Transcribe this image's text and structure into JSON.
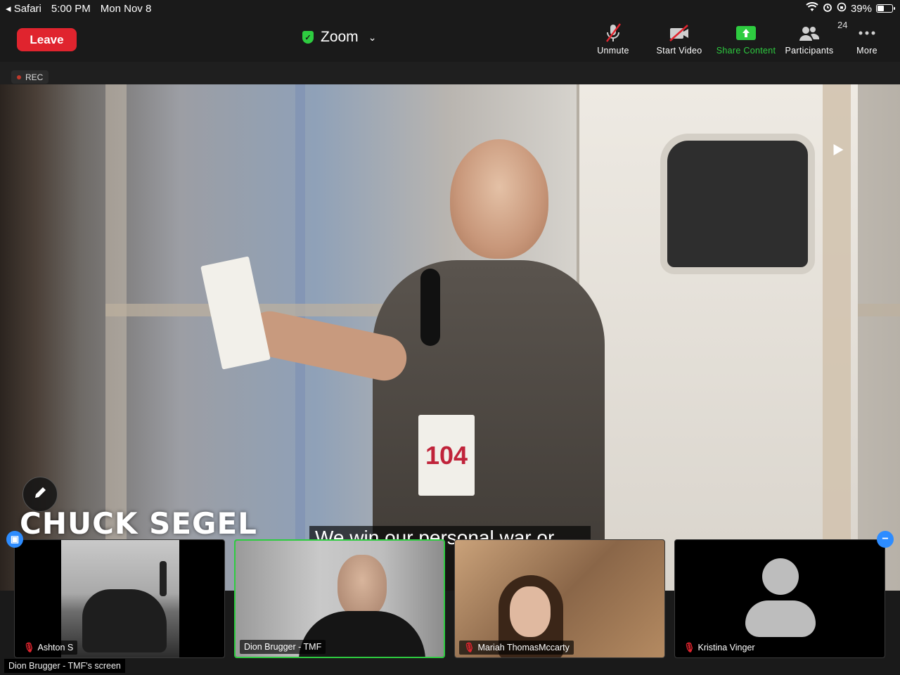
{
  "status_bar": {
    "back_app": "Safari",
    "time": "5:00 PM",
    "date": "Mon Nov 8",
    "battery": "39%",
    "battery_level": 0.39
  },
  "toolbar": {
    "leave_label": "Leave",
    "meeting_title": "Zoom",
    "buttons": {
      "unmute": "Unmute",
      "start_video": "Start Video",
      "share_content": "Share Content",
      "participants": "Participants",
      "participants_count": "24",
      "more": "More"
    }
  },
  "recording": {
    "label": "REC"
  },
  "shared_screen": {
    "name_overlay": "CHUCK SEGEL",
    "caption": "We win our personal war or",
    "bib_number": "104",
    "owner_label": "Dion Brugger - TMF's screen"
  },
  "participants": [
    {
      "name": "Ashton S",
      "muted": true
    },
    {
      "name": "Dion Brugger - TMF",
      "muted": false,
      "active_speaker": true
    },
    {
      "name": "Mariah ThomasMccarty",
      "muted": true
    },
    {
      "name": "Kristina Vinger",
      "muted": true,
      "video": false
    }
  ],
  "colors": {
    "leave": "#e0242e",
    "share_green": "#2ecc40",
    "toolbar_bg": "#1a1a1a",
    "edge_blue": "#2d8cff"
  }
}
